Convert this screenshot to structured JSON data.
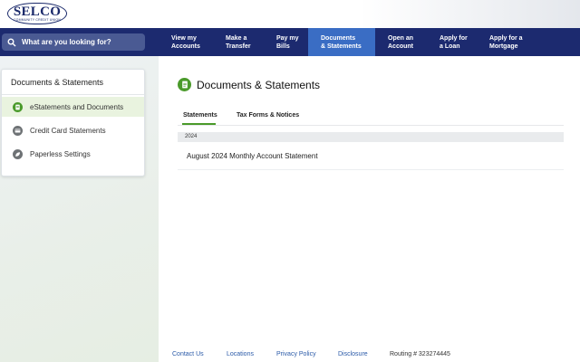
{
  "header": {
    "logo_main": "SELCO",
    "logo_sub": "COMMUNITY CREDIT UNION"
  },
  "search": {
    "placeholder": "What are you looking for?"
  },
  "nav": [
    {
      "line1": "View my",
      "line2": "Accounts"
    },
    {
      "line1": "Make a",
      "line2": "Transfer"
    },
    {
      "line1": "Pay my",
      "line2": "Bills"
    },
    {
      "line1": "Documents",
      "line2": "& Statements"
    },
    {
      "line1": "Open an",
      "line2": "Account"
    },
    {
      "line1": "Apply for",
      "line2": "a Loan"
    },
    {
      "line1": "Apply for a",
      "line2": "Mortgage"
    }
  ],
  "sidebar": {
    "title": "Documents & Statements",
    "items": [
      {
        "label": "eStatements and Documents",
        "icon": "document-icon"
      },
      {
        "label": "Credit Card Statements",
        "icon": "credit-card-icon"
      },
      {
        "label": "Paperless Settings",
        "icon": "leaf-icon"
      }
    ]
  },
  "main": {
    "title": "Documents & Statements",
    "tabs": [
      {
        "label": "Statements"
      },
      {
        "label": "Tax Forms & Notices"
      }
    ],
    "year": "2024",
    "documents": [
      {
        "label": "August 2024 Monthly Account Statement"
      }
    ]
  },
  "footer": {
    "links": [
      {
        "label": "Contact Us"
      },
      {
        "label": "Locations"
      },
      {
        "label": "Privacy Policy"
      },
      {
        "label": "Disclosure"
      }
    ],
    "routing": "Routing # 323274445"
  },
  "colors": {
    "navy": "#1c2a6f",
    "active_nav": "#3a6dc4",
    "green": "#4a9a2a",
    "link": "#2a5aa8"
  }
}
